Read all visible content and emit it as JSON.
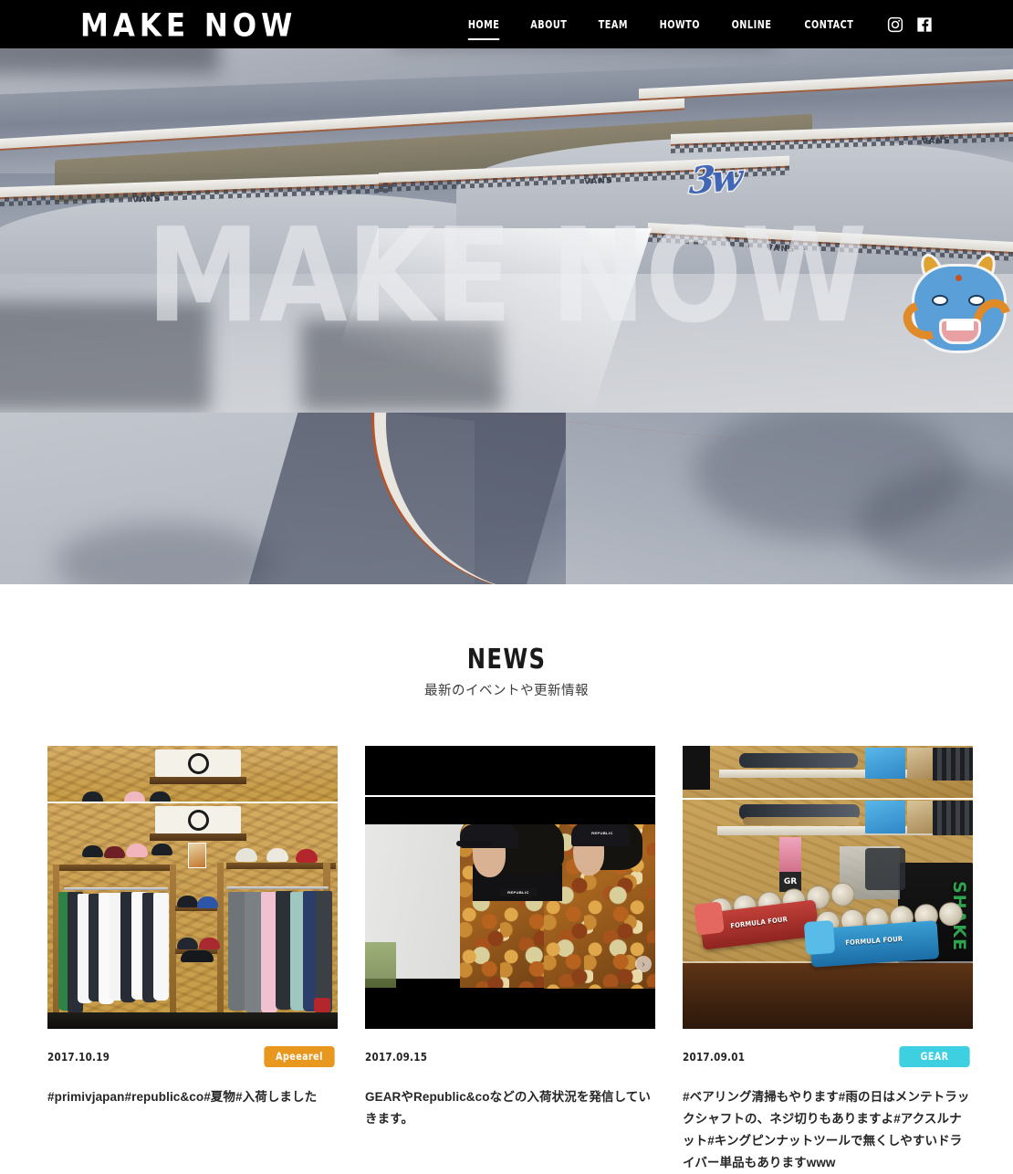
{
  "site": {
    "logo": "MAKE NOW",
    "hero_title": "MAKE NOW"
  },
  "nav": {
    "items": [
      {
        "label": "HOME",
        "active": true
      },
      {
        "label": "ABOUT",
        "active": false
      },
      {
        "label": "TEAM",
        "active": false
      },
      {
        "label": "HOWTO",
        "active": false
      },
      {
        "label": "ONLINE",
        "active": false
      },
      {
        "label": "CONTACT",
        "active": false
      }
    ],
    "social": [
      {
        "name": "instagram-icon"
      },
      {
        "name": "facebook-icon"
      }
    ]
  },
  "news": {
    "heading": "NEWS",
    "subheading": "最新のイベントや更新情報",
    "cards": [
      {
        "date": "2017.10.19",
        "badge": "Apeearel",
        "badge_color": "#e8981f",
        "text": "#primivjapan#republic&co#夏物#入荷しました",
        "image_alt": "shop-interior-apparel-rack"
      },
      {
        "date": "2017.09.15",
        "badge": "",
        "badge_color": "",
        "text": "GEARやRepublic&coなどの入荷状況を発信していきます。",
        "image_alt": "two-people-leaf-camo-jackets",
        "next_arrow": "›"
      },
      {
        "date": "2017.09.01",
        "badge": "GEAR",
        "badge_color": "#3ecfe0",
        "text": "#ベアリング清掃もやります#雨の日はメンテトラックシャフトの、ネジ切りもありますよ#アクスルナット#キングピンナットツールで無くしやすいドライバー単品もありますwww",
        "image_alt": "spitfire-formula-four-wheels-counter"
      }
    ]
  },
  "brand_marks": {
    "vans": "VANS",
    "spitfire_red": "FORMULA FOUR",
    "spitfire_blue": "FORMULA FOUR",
    "shake": "SHAKE"
  },
  "colors": {
    "header_bg": "#000000",
    "page_bg": "#ffffff",
    "text": "#262626",
    "badge_apparel": "#e8981f",
    "badge_gear": "#3ecfe0"
  }
}
